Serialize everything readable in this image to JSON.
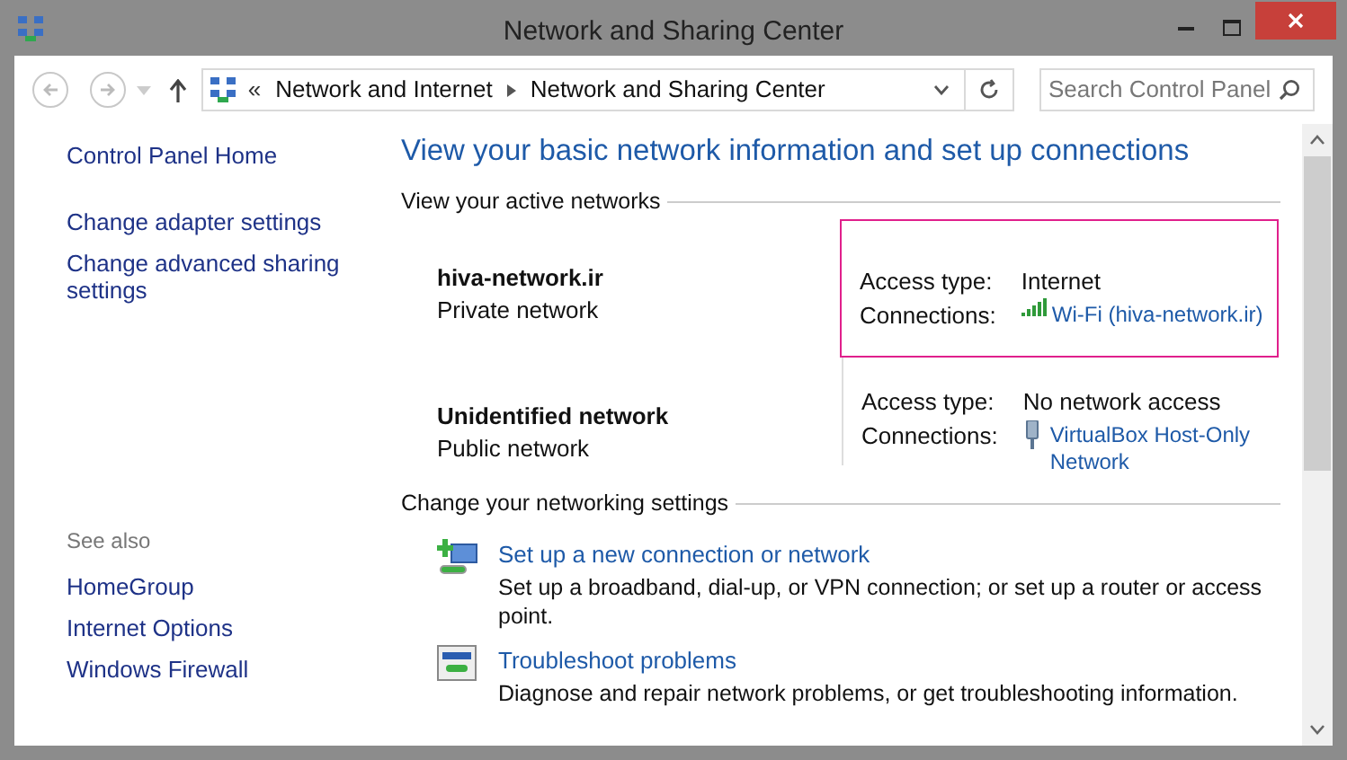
{
  "window": {
    "title": "Network and Sharing Center"
  },
  "address_bar": {
    "overflow": "«",
    "crumbs": [
      "Network and Internet",
      "Network and Sharing Center"
    ]
  },
  "search": {
    "placeholder": "Search Control Panel"
  },
  "sidebar": {
    "items": [
      "Control Panel Home",
      "Change adapter settings",
      "Change advanced sharing settings"
    ],
    "see_also": {
      "heading": "See also",
      "items": [
        "HomeGroup",
        "Internet Options",
        "Windows Firewall"
      ]
    }
  },
  "heading": "View your basic network information and set up connections",
  "active_networks": {
    "heading": "View your active networks",
    "networks": [
      {
        "name": "hiva-network.ir",
        "type": "Private network",
        "access_label": "Access type:",
        "access": "Internet",
        "connections_label": "Connections:",
        "connection": "Wi-Fi (hiva-network.ir)",
        "kind": "wifi",
        "highlighted": true
      },
      {
        "name": "Unidentified network",
        "type": "Public network",
        "access_label": "Access type:",
        "access": "No network access",
        "connections_label": "Connections:",
        "connection": "VirtualBox Host-Only Network",
        "kind": "ethernet",
        "highlighted": false
      }
    ]
  },
  "settings": {
    "heading": "Change your networking settings",
    "tasks": [
      {
        "kind": "new",
        "title": "Set up a new connection or network",
        "description": "Set up a broadband, dial-up, or VPN connection; or set up a router or access point."
      },
      {
        "kind": "troubleshoot",
        "title": "Troubleshoot problems",
        "description": "Diagnose and repair network problems, or get troubleshooting information."
      }
    ]
  }
}
